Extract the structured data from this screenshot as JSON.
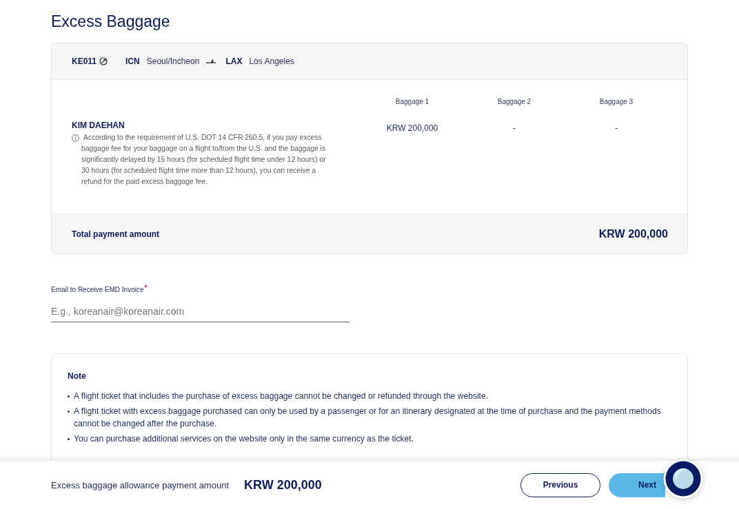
{
  "page_title": "Excess Baggage",
  "flight": {
    "number": "KE011",
    "origin_code": "ICN",
    "origin_city": "Seoul/Incheon",
    "destination_code": "LAX",
    "destination_city": "Los Angeles"
  },
  "baggage_table": {
    "columns": [
      "Baggage 1",
      "Baggage 2",
      "Baggage 3"
    ],
    "passengers": [
      {
        "name": "KIM DAEHAN",
        "notice": "According to the requirement of U.S. DOT 14 CFR 260.5, if you pay excess baggage fee for your baggage on a flight to/from the U.S. and the baggage is significantly delayed by 15 hours (for scheduled flight time under 12 hours) or 30 hours (for scheduled flight time more than 12 hours), you can receive a refund for the paid excess baggage fee.",
        "values": [
          "KRW 200,000",
          "-",
          "-"
        ]
      }
    ]
  },
  "total": {
    "label": "Total payment amount",
    "amount": "KRW 200,000"
  },
  "email_field": {
    "label": "Email to Receive EMD Invoice",
    "required": true,
    "placeholder": "E.g., koreanair@koreanair.com"
  },
  "note": {
    "title": "Note",
    "items": [
      "A flight ticket that includes the purchase of excess baggage cannot be changed or refunded through the website.",
      "A flight ticket with excess baggage purchased can only be used by a passenger or for an itinerary designated at the time of purchase and the payment methods cannot be changed after the purchase.",
      "You can purchase additional services on the website only in the same currency as the ticket."
    ]
  },
  "footer": {
    "label": "Excess baggage allowance payment amount",
    "amount": "KRW 200,000",
    "buttons": [
      {
        "label": "Previous",
        "kind": "secondary"
      },
      {
        "label": "Next",
        "kind": "primary"
      }
    ]
  }
}
